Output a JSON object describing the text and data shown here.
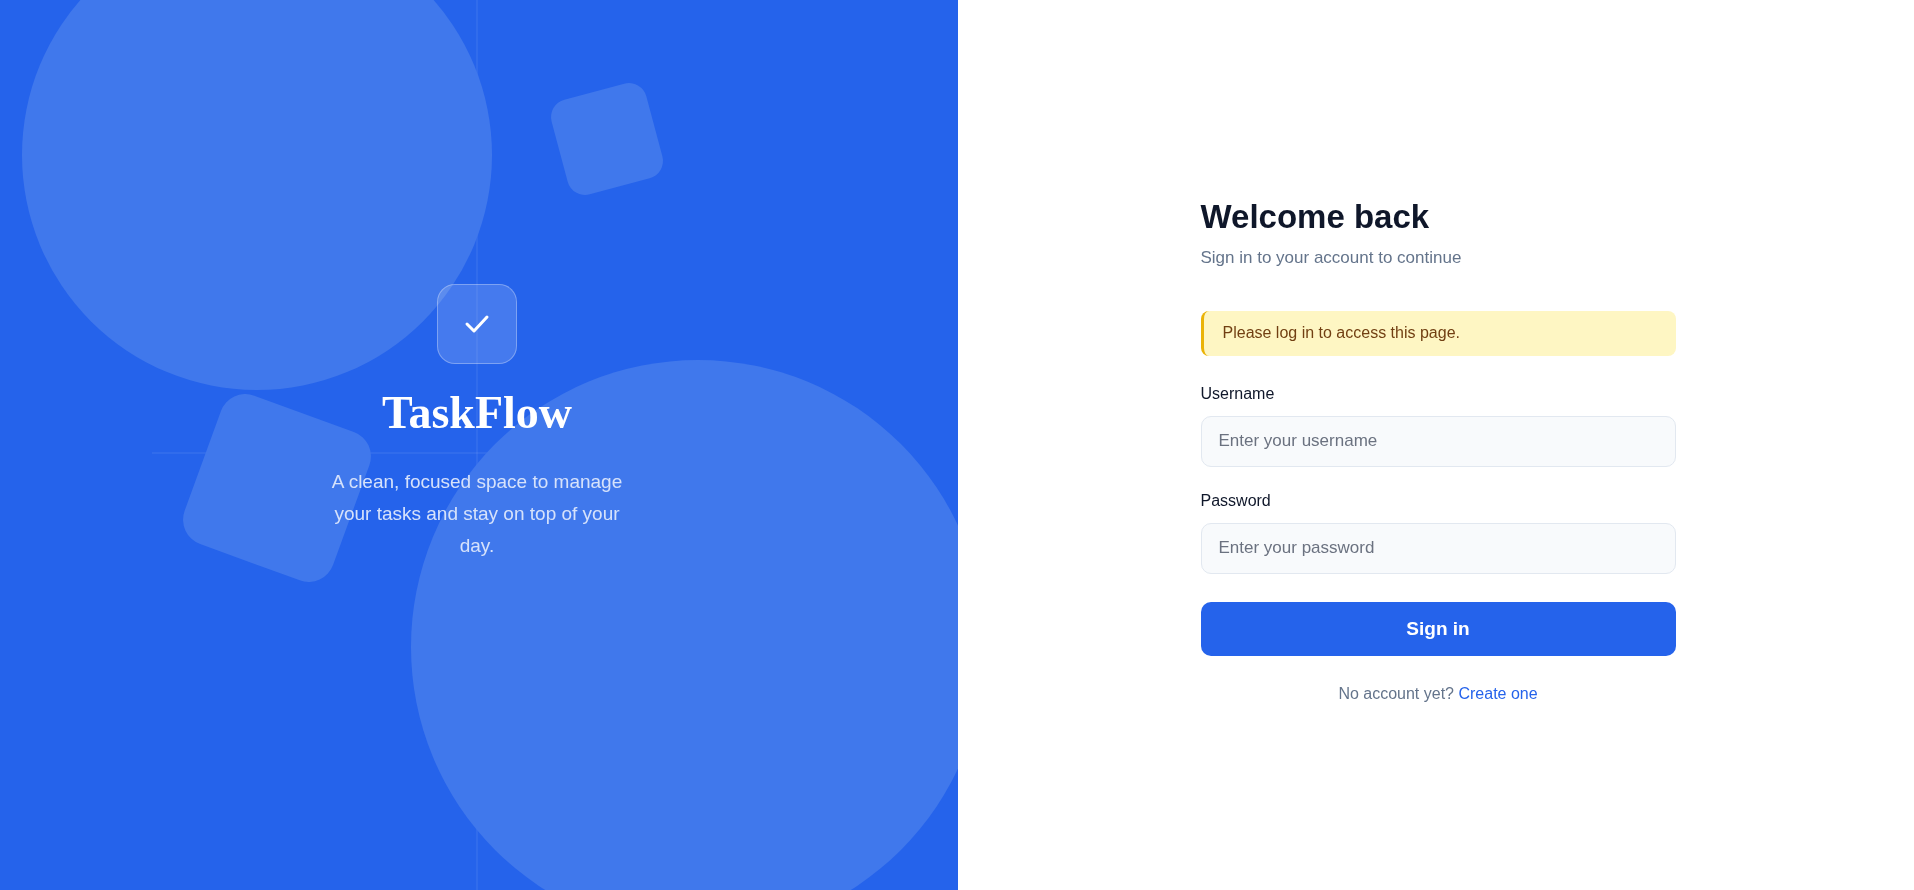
{
  "brand": {
    "name": "TaskFlow",
    "tagline": "A clean, focused space to manage your tasks and stay on top of your day."
  },
  "form": {
    "title": "Welcome back",
    "subtitle": "Sign in to your account to continue",
    "alert": {
      "kind": "warning",
      "text": "Please log in to access this page."
    },
    "fields": [
      {
        "label": "Username",
        "placeholder": "Enter your username"
      },
      {
        "label": "Password",
        "placeholder": "Enter your password"
      }
    ],
    "submit": "Sign in",
    "footer": {
      "text": "No account yet?",
      "link": "Create one"
    }
  }
}
